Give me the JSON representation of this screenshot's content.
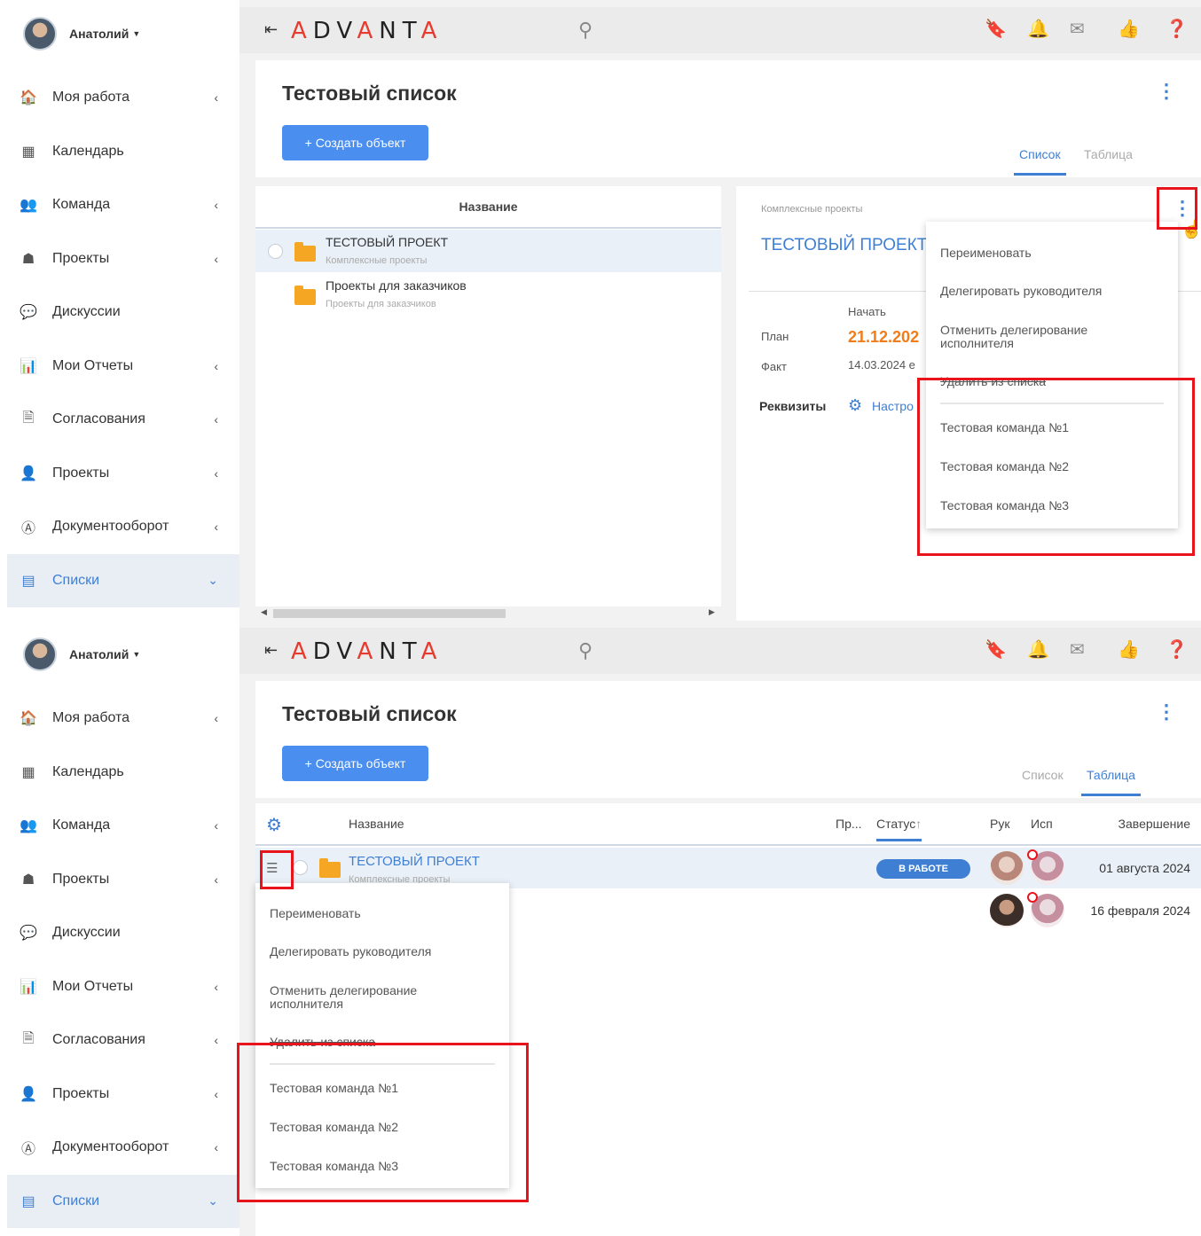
{
  "user": {
    "name": "Анатолий"
  },
  "menu": [
    {
      "label": "Моя работа",
      "icon": "home-icon",
      "glyph": "🏠",
      "has_chevron": true
    },
    {
      "label": "Календарь",
      "icon": "calendar-icon",
      "glyph": "▦",
      "has_chevron": false
    },
    {
      "label": "Команда",
      "icon": "team-icon",
      "glyph": "👥",
      "has_chevron": true
    },
    {
      "label": "Проекты",
      "icon": "hierarchy-icon",
      "glyph": "☗",
      "has_chevron": true
    },
    {
      "label": "Дискуссии",
      "icon": "chat-icon",
      "glyph": "💬",
      "has_chevron": false
    },
    {
      "label": "Мои Отчеты",
      "icon": "chart-icon",
      "glyph": "📊",
      "has_chevron": true
    },
    {
      "label": "Согласования",
      "icon": "document-check-icon",
      "glyph": "🗎",
      "has_chevron": true
    },
    {
      "label": "Проекты",
      "icon": "person-icon",
      "glyph": "👤",
      "has_chevron": true
    },
    {
      "label": "Документооборот",
      "icon": "document-flow-icon",
      "glyph": "Ⓐ",
      "has_chevron": true
    },
    {
      "label": "Списки",
      "icon": "list-icon",
      "glyph": "▤",
      "has_chevron": true,
      "active": true
    }
  ],
  "topbar": {
    "logo": "ADVANTA"
  },
  "page": {
    "title": "Тестовый список",
    "create_button": "+ Создать объект",
    "tabs": [
      "Список",
      "Таблица"
    ]
  },
  "list_view": {
    "column": "Название",
    "rows": [
      {
        "title": "ТЕСТОВЫЙ ПРОЕКТ",
        "subtitle": "Комплексные проекты"
      },
      {
        "title": "Проекты для заказчиков",
        "subtitle": "Проекты для заказчиков"
      }
    ]
  },
  "detail": {
    "crumb": "Комплексные проекты",
    "title": "ТЕСТОВЫЙ ПРОЕКТ",
    "start_label": "Начать",
    "plan_label": "План",
    "plan_value": "21.12.202",
    "fact_label": "Факт",
    "fact_value": "14.03.2024 е",
    "requisites_label": "Реквизиты",
    "settings_link": "Настро"
  },
  "context_menu": {
    "items": [
      "Переименовать",
      "Делегировать руководителя",
      "Отменить делегирование исполнителя",
      "Удалить из списка"
    ],
    "teams": [
      "Тестовая команда №1",
      "Тестовая команда №2",
      "Тестовая команда №3"
    ]
  },
  "table_view": {
    "columns": {
      "name": "Название",
      "pr": "Пр...",
      "status": "Статус",
      "ruk": "Рук",
      "isp": "Исп",
      "end": "Завершение"
    },
    "rows": [
      {
        "title": "ТЕСТОВЫЙ ПРОЕКТ",
        "subtitle": "Комплексные проекты",
        "status": "В РАБОТЕ",
        "end": "01 августа 2024"
      },
      {
        "title": "",
        "subtitle": "",
        "status": "",
        "end": "16 февраля 2024"
      }
    ]
  },
  "colors": {
    "accent": "#3f7fd3",
    "highlight": "#e8141b",
    "orange": "#f07c1a",
    "button": "#4a8ef0"
  }
}
